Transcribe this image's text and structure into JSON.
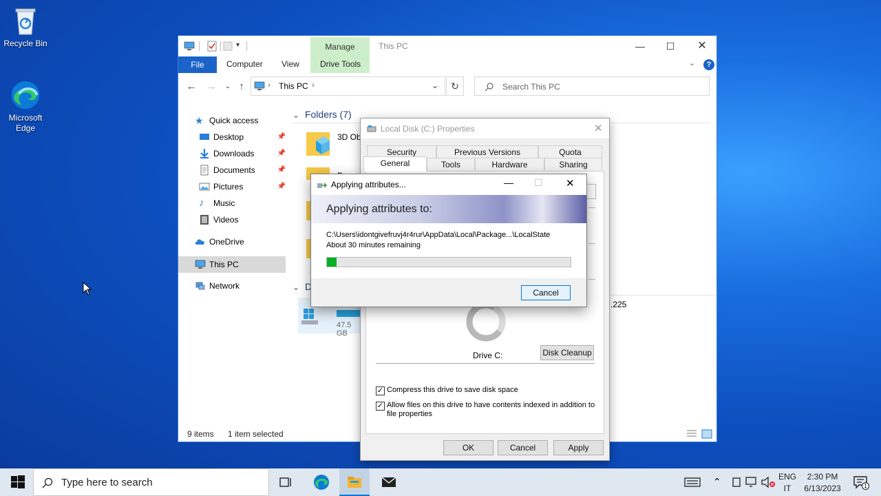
{
  "desktop": {
    "icons": [
      {
        "label": "Recycle Bin"
      },
      {
        "label": "Microsoft Edge"
      }
    ]
  },
  "explorer": {
    "title": "This PC",
    "manage_tab": "Manage",
    "ribbon_tabs": [
      "File",
      "Computer",
      "View",
      "Drive Tools"
    ],
    "address_path": "This PC",
    "search_placeholder": "Search This PC",
    "nav": {
      "quick_access": "Quick access",
      "quick_items": [
        "Desktop",
        "Downloads",
        "Documents",
        "Pictures",
        "Music",
        "Videos"
      ],
      "onedrive": "OneDrive",
      "this_pc": "This PC",
      "network": "Network"
    },
    "content": {
      "folders_header": "Folders (7)",
      "folder_3d": "3D Obj",
      "folder_do": "Docu",
      "devices_header_fragment": "D",
      "drive_size_fragment": "47.5 GB",
      "right_fragment": ".225"
    },
    "status": {
      "items": "9 items",
      "selected": "1 item selected"
    }
  },
  "properties": {
    "title": "Local Disk (C:) Properties",
    "tabs_row1": [
      "Security",
      "Previous Versions",
      "Quota"
    ],
    "tabs_row2": [
      "General",
      "Tools",
      "Hardware",
      "Sharing"
    ],
    "drive_label": "Drive C:",
    "disk_cleanup": "Disk Cleanup",
    "compress_label": "Compress this drive to save disk space",
    "compress_checked": true,
    "index_label_line1": "Allow files on this drive to have contents indexed in addition to",
    "index_label_line2": "file properties",
    "index_checked": true,
    "ok": "OK",
    "cancel": "Cancel",
    "apply": "Apply"
  },
  "applying": {
    "title": "Applying attributes...",
    "banner": "Applying attributes to:",
    "path": "C:\\Users\\idontgivefruvj4r4rur\\AppData\\Local\\Package...\\LocalState",
    "remaining": "About 30 minutes remaining",
    "progress": 0.04,
    "cancel": "Cancel"
  },
  "taskbar": {
    "search_placeholder": "Type here to search",
    "lang_top": "ENG",
    "lang_bottom": "IT",
    "time": "2:30 PM",
    "date": "6/13/2023",
    "notification_count": "1"
  },
  "colors": {
    "accent": "#1a63c9",
    "manage_tab": "#cdeecb",
    "progress": "#06b025",
    "selected_nav": "#d9d9d9"
  }
}
